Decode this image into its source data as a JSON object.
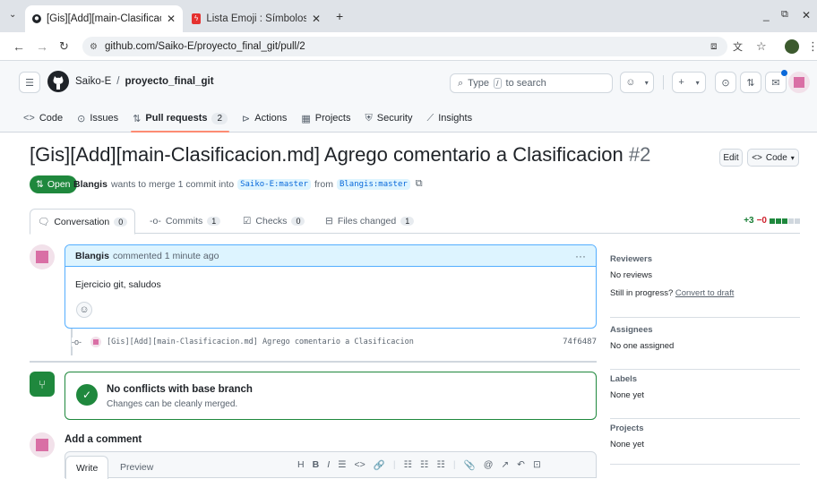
{
  "browser": {
    "tabs": [
      {
        "title": "[Gis][Add][main-Clasificacion.md]",
        "active": true
      },
      {
        "title": "Lista Emoji : Símbolos en",
        "active": false
      }
    ],
    "new_tab": "+",
    "url": "github.com/Saiko-E/proyecto_final_git/pull/2"
  },
  "header": {
    "owner": "Saiko-E",
    "separator": "/",
    "repo": "proyecto_final_git",
    "search_placeholder_pre": "Type",
    "search_key": "/",
    "search_placeholder_post": "to search"
  },
  "repo_nav": [
    {
      "label": "Code",
      "icon": "<>"
    },
    {
      "label": "Issues",
      "icon": "⊙"
    },
    {
      "label": "Pull requests",
      "icon": "⇅",
      "count": "2",
      "selected": true
    },
    {
      "label": "Actions",
      "icon": "▶"
    },
    {
      "label": "Projects",
      "icon": "▦"
    },
    {
      "label": "Security",
      "icon": "⛨"
    },
    {
      "label": "Insights",
      "icon": "⟋"
    }
  ],
  "pr": {
    "title": "[Gis][Add][main-Clasificacion.md] Agrego comentario a Clasificacion",
    "number": "#2",
    "edit_label": "Edit",
    "code_label": "Code",
    "state": "Open",
    "author": "Blangis",
    "meta_mid": "wants to merge 1 commit into",
    "base_branch": "Saiko-E:master",
    "meta_from": "from",
    "head_branch": "Blangis:master"
  },
  "pr_tabs": [
    {
      "label": "Conversation",
      "count": "0",
      "active": true
    },
    {
      "label": "Commits",
      "count": "1"
    },
    {
      "label": "Checks",
      "count": "0"
    },
    {
      "label": "Files changed",
      "count": "1"
    }
  ],
  "diffstat": {
    "added": "+3",
    "removed": "−0"
  },
  "comment": {
    "author": "Blangis",
    "action": "commented 1 minute ago",
    "body": "Ejercicio git, saludos",
    "menu": "···"
  },
  "commit": {
    "message": "[Gis][Add][main-Clasificacion.md] Agrego comentario a Clasificacion",
    "sha": "74f6487"
  },
  "merge": {
    "title": "No conflicts with base branch",
    "subtitle": "Changes can be cleanly merged."
  },
  "add_comment": {
    "heading": "Add a comment",
    "write_tab": "Write",
    "preview_tab": "Preview",
    "toolbar": [
      "H",
      "B",
      "I",
      "☰",
      "<>",
      "🔗",
      "☷",
      "☷",
      "☷",
      "📎",
      "@",
      "↗",
      "↶",
      "⊡"
    ]
  },
  "sidebar": {
    "reviewers_title": "Reviewers",
    "reviewers_value": "No reviews",
    "in_progress": "Still in progress?",
    "convert_draft": "Convert to draft",
    "assignees_title": "Assignees",
    "assignees_value": "No one assigned",
    "labels_title": "Labels",
    "labels_value": "None yet",
    "projects_title": "Projects",
    "projects_value": "None yet"
  },
  "colors": {
    "open_green": "#1f883d",
    "link_blue": "#0969da",
    "comment_border": "#54aeff",
    "selected_underline": "#fd8c73"
  }
}
